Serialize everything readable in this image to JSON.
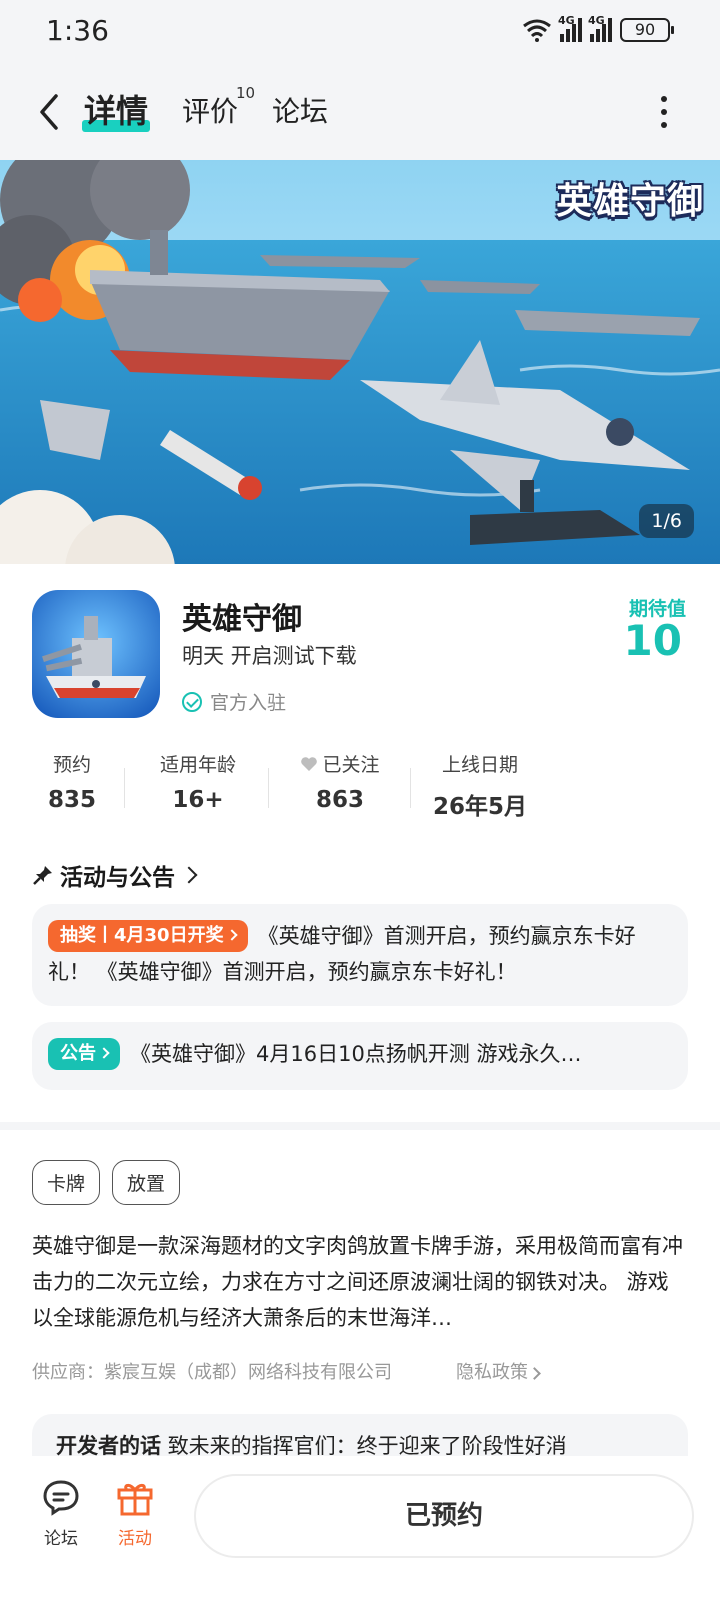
{
  "status_bar": {
    "time": "1:36",
    "network": "4G",
    "battery": "90"
  },
  "nav": {
    "tabs": [
      {
        "label": "详情",
        "active": true
      },
      {
        "label": "评价",
        "badge": "10"
      },
      {
        "label": "论坛"
      }
    ]
  },
  "banner": {
    "logo_text": "英雄守御",
    "counter": "1/6"
  },
  "app": {
    "name": "英雄守御",
    "subtitle": "明天 开启测试下载",
    "official": "官方入驻",
    "expect_label": "期待值",
    "expect_value": "10"
  },
  "stats": [
    {
      "label": "预约",
      "value": "835"
    },
    {
      "label": "适用年龄",
      "value": "16+"
    },
    {
      "label": "已关注",
      "value": "863"
    },
    {
      "label": "上线日期",
      "value": "26年5月"
    }
  ],
  "activity": {
    "title": "活动与公告",
    "items": [
      {
        "pill": "抽奖丨4月30日开奖",
        "text": "《英雄守御》首测开启，预约赢京东卡好礼！ 《英雄守御》首测开启，预约赢京东卡好礼！"
      },
      {
        "pill": "公告",
        "text": "《英雄守御》4月16日10点扬帆开测 游戏永久…"
      }
    ]
  },
  "tags": [
    "卡牌",
    "放置"
  ],
  "description": "英雄守御是一款深海题材的文字肉鸽放置卡牌手游，采用极简而富有冲击力的二次元立绘，力求在方寸之间还原波澜壮阔的钢铁对决。 游戏以全球能源危机与经济大萧条后的末世海洋…",
  "provider": "供应商：紫宸互娱（成都）网络科技有限公司",
  "privacy": "隐私政策",
  "developer_note": {
    "title": "开发者的话",
    "text": "致未来的指挥官们：终于迎来了阶段性好消"
  },
  "bottom_bar": {
    "forum": "论坛",
    "activity": "活动",
    "reserve_button": "已预约"
  },
  "colors": {
    "accent": "#19c1b3",
    "orange": "#f5682f"
  }
}
